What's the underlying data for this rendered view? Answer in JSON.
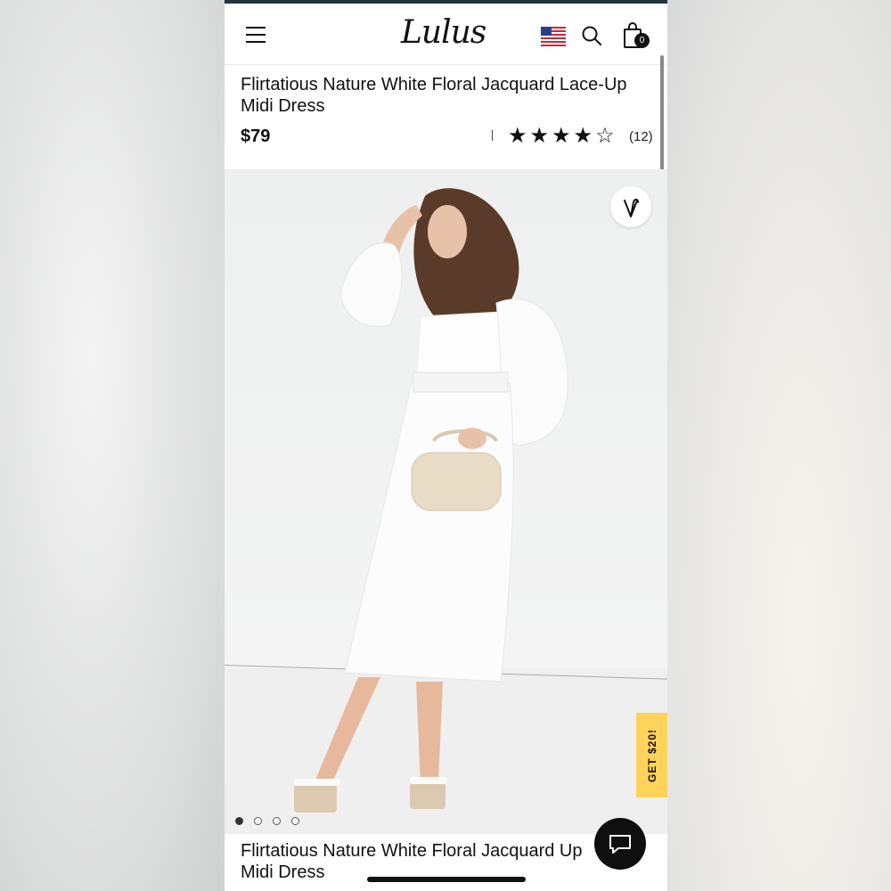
{
  "header": {
    "logo": "Lulus",
    "cart_count": "0"
  },
  "product": {
    "title": "Flirtatious Nature White Floral Jacquard Lace-Up Midi Dress",
    "price": "$79",
    "rating": 4,
    "rating_max": 5,
    "stars": "★★★★☆",
    "review_count": "(12)",
    "carousel_total": 4,
    "carousel_active": 1
  },
  "promo": {
    "label": "GET $20!"
  },
  "sticky": {
    "title": "Flirtatious Nature White Floral Jacquard Up Midi Dress"
  },
  "colors": {
    "accent": "#ffd35a",
    "topline": "#20333a"
  },
  "icons": [
    "menu-icon",
    "us-flag-icon",
    "search-icon",
    "shopping-bag-icon",
    "heart-icon",
    "chat-icon"
  ]
}
